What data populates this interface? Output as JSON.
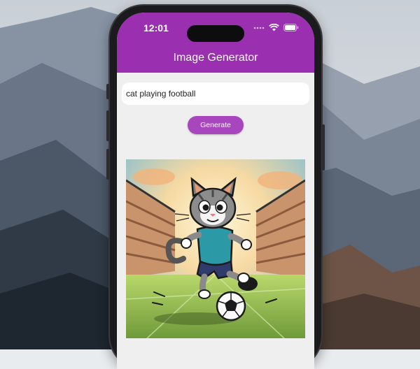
{
  "status_bar": {
    "time": "12:01",
    "icons": [
      "signal-dots-icon",
      "wifi-icon",
      "battery-icon"
    ]
  },
  "app": {
    "title": "Image Generator",
    "prompt_input": {
      "value": "cat playing football",
      "placeholder": ""
    },
    "generate_button": "Generate",
    "generated_image": {
      "subject": "cartoon cat kicking a football in a stadium"
    }
  },
  "colors": {
    "app_bar": "#9a2fb0",
    "button": "#a746bd",
    "screen_bg": "#efefef"
  }
}
